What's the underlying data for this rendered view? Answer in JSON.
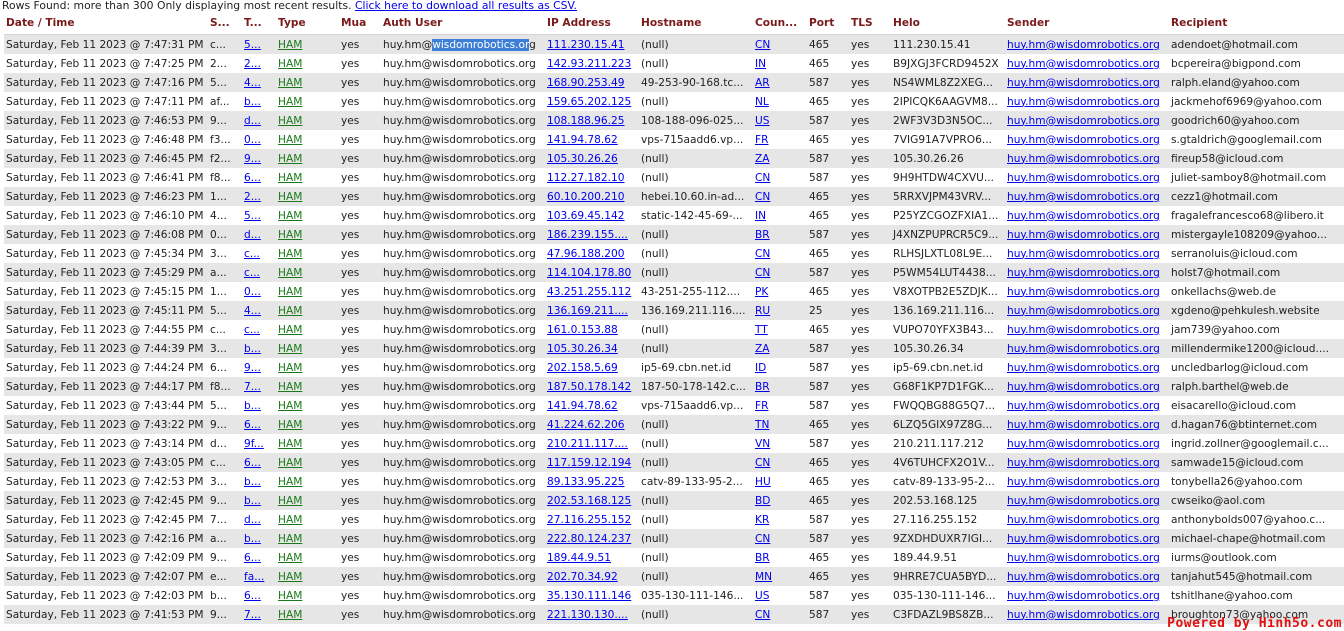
{
  "info": {
    "text": "Rows Found: more than 300 Only displaying most recent results.",
    "link": "Click here to download all results as CSV."
  },
  "columns": [
    "Date / Time",
    "S...",
    "T...",
    "Type",
    "Mua",
    "Auth User",
    "IP Address",
    "Hostname",
    "Coun...",
    "Port",
    "TLS",
    "Helo",
    "Sender",
    "Recipient"
  ],
  "rows": [
    {
      "date": "Saturday, Feb 11 2023 @ 7:47:31 PM",
      "s": "c...",
      "t": "5...",
      "type": "HAM",
      "mua": "yes",
      "auth": "huy.hm@wisdomrobotics.org",
      "ip": "111.230.15.41",
      "host": "(null)",
      "country": "CN",
      "port": "465",
      "tls": "yes",
      "helo": "111.230.15.41",
      "sender": "huy.hm@wisdomrobotics.org",
      "recipient": "adendoet@hotmail.com"
    },
    {
      "date": "Saturday, Feb 11 2023 @ 7:47:25 PM",
      "s": "2...",
      "t": "2...",
      "type": "HAM",
      "mua": "yes",
      "auth": "huy.hm@wisdomrobotics.org",
      "ip": "142.93.211.223",
      "host": "(null)",
      "country": "IN",
      "port": "465",
      "tls": "yes",
      "helo": "B9JXGJ3FCRD9452X",
      "sender": "huy.hm@wisdomrobotics.org",
      "recipient": "bcpereira@bigpond.com"
    },
    {
      "date": "Saturday, Feb 11 2023 @ 7:47:16 PM",
      "s": "5...",
      "t": "4...",
      "type": "HAM",
      "mua": "yes",
      "auth": "huy.hm@wisdomrobotics.org",
      "ip": "168.90.253.49",
      "host": "49-253-90-168.tc...",
      "country": "AR",
      "port": "587",
      "tls": "yes",
      "helo": "NS4WML8Z2XEG...",
      "sender": "huy.hm@wisdomrobotics.org",
      "recipient": "ralph.eland@yahoo.com"
    },
    {
      "date": "Saturday, Feb 11 2023 @ 7:47:11 PM",
      "s": "af...",
      "t": "b...",
      "type": "HAM",
      "mua": "yes",
      "auth": "huy.hm@wisdomrobotics.org",
      "ip": "159.65.202.125",
      "host": "(null)",
      "country": "NL",
      "port": "465",
      "tls": "yes",
      "helo": "2IPICQK6AAGVM8...",
      "sender": "huy.hm@wisdomrobotics.org",
      "recipient": "jackmehof6969@yahoo.com"
    },
    {
      "date": "Saturday, Feb 11 2023 @ 7:46:53 PM",
      "s": "9...",
      "t": "d...",
      "type": "HAM",
      "mua": "yes",
      "auth": "huy.hm@wisdomrobotics.org",
      "ip": "108.188.96.25",
      "host": "108-188-096-025...",
      "country": "US",
      "port": "587",
      "tls": "yes",
      "helo": "2WF3V3D3N5OC...",
      "sender": "huy.hm@wisdomrobotics.org",
      "recipient": "goodrich60@yahoo.com"
    },
    {
      "date": "Saturday, Feb 11 2023 @ 7:46:48 PM",
      "s": "f3...",
      "t": "0...",
      "type": "HAM",
      "mua": "yes",
      "auth": "huy.hm@wisdomrobotics.org",
      "ip": "141.94.78.62",
      "host": "vps-715aadd6.vp...",
      "country": "FR",
      "port": "465",
      "tls": "yes",
      "helo": "7VIG91A7VPRO6...",
      "sender": "huy.hm@wisdomrobotics.org",
      "recipient": "s.gtaldrich@googlemail.com"
    },
    {
      "date": "Saturday, Feb 11 2023 @ 7:46:45 PM",
      "s": "f2...",
      "t": "9...",
      "type": "HAM",
      "mua": "yes",
      "auth": "huy.hm@wisdomrobotics.org",
      "ip": "105.30.26.26",
      "host": "(null)",
      "country": "ZA",
      "port": "587",
      "tls": "yes",
      "helo": "105.30.26.26",
      "sender": "huy.hm@wisdomrobotics.org",
      "recipient": "fireup58@icloud.com"
    },
    {
      "date": "Saturday, Feb 11 2023 @ 7:46:41 PM",
      "s": "f8...",
      "t": "6...",
      "type": "HAM",
      "mua": "yes",
      "auth": "huy.hm@wisdomrobotics.org",
      "ip": "112.27.182.10",
      "host": "(null)",
      "country": "CN",
      "port": "587",
      "tls": "yes",
      "helo": "9H9HTDW4CXVU...",
      "sender": "huy.hm@wisdomrobotics.org",
      "recipient": "juliet-samboy8@hotmail.com"
    },
    {
      "date": "Saturday, Feb 11 2023 @ 7:46:23 PM",
      "s": "1...",
      "t": "2...",
      "type": "HAM",
      "mua": "yes",
      "auth": "huy.hm@wisdomrobotics.org",
      "ip": "60.10.200.210",
      "host": "hebei.10.60.in-ad...",
      "country": "CN",
      "port": "465",
      "tls": "yes",
      "helo": "5RRXVJPM43VRV...",
      "sender": "huy.hm@wisdomrobotics.org",
      "recipient": "cezz1@hotmail.com"
    },
    {
      "date": "Saturday, Feb 11 2023 @ 7:46:10 PM",
      "s": "4...",
      "t": "5...",
      "type": "HAM",
      "mua": "yes",
      "auth": "huy.hm@wisdomrobotics.org",
      "ip": "103.69.45.142",
      "host": "static-142-45-69-...",
      "country": "IN",
      "port": "465",
      "tls": "yes",
      "helo": "P25YZCGOZFXIA1...",
      "sender": "huy.hm@wisdomrobotics.org",
      "recipient": "fragalefrancesco68@libero.it"
    },
    {
      "date": "Saturday, Feb 11 2023 @ 7:46:08 PM",
      "s": "0...",
      "t": "d...",
      "type": "HAM",
      "mua": "yes",
      "auth": "huy.hm@wisdomrobotics.org",
      "ip": "186.239.155....",
      "host": "(null)",
      "country": "BR",
      "port": "587",
      "tls": "yes",
      "helo": "J4XNZPUPRCR5C9...",
      "sender": "huy.hm@wisdomrobotics.org",
      "recipient": "mistergayle108209@yahoo..."
    },
    {
      "date": "Saturday, Feb 11 2023 @ 7:45:34 PM",
      "s": "3...",
      "t": "c...",
      "type": "HAM",
      "mua": "yes",
      "auth": "huy.hm@wisdomrobotics.org",
      "ip": "47.96.188.200",
      "host": "(null)",
      "country": "CN",
      "port": "465",
      "tls": "yes",
      "helo": "RLHSJLXTL08L9E...",
      "sender": "huy.hm@wisdomrobotics.org",
      "recipient": "serranoluis@icloud.com"
    },
    {
      "date": "Saturday, Feb 11 2023 @ 7:45:29 PM",
      "s": "a...",
      "t": "c...",
      "type": "HAM",
      "mua": "yes",
      "auth": "huy.hm@wisdomrobotics.org",
      "ip": "114.104.178.80",
      "host": "(null)",
      "country": "CN",
      "port": "587",
      "tls": "yes",
      "helo": "P5WM54LUT4438...",
      "sender": "huy.hm@wisdomrobotics.org",
      "recipient": "holst7@hotmail.com"
    },
    {
      "date": "Saturday, Feb 11 2023 @ 7:45:15 PM",
      "s": "1...",
      "t": "0...",
      "type": "HAM",
      "mua": "yes",
      "auth": "huy.hm@wisdomrobotics.org",
      "ip": "43.251.255.112",
      "host": "43-251-255-112....",
      "country": "PK",
      "port": "465",
      "tls": "yes",
      "helo": "V8XOTPB2E5ZDJK...",
      "sender": "huy.hm@wisdomrobotics.org",
      "recipient": "onkellachs@web.de"
    },
    {
      "date": "Saturday, Feb 11 2023 @ 7:45:11 PM",
      "s": "5...",
      "t": "4...",
      "type": "HAM",
      "mua": "yes",
      "auth": "huy.hm@wisdomrobotics.org",
      "ip": "136.169.211....",
      "host": "136.169.211.116....",
      "country": "RU",
      "port": "25",
      "tls": "yes",
      "helo": "136.169.211.116...",
      "sender": "huy.hm@wisdomrobotics.org",
      "recipient": "xgdeno@pehkulesh.website"
    },
    {
      "date": "Saturday, Feb 11 2023 @ 7:44:55 PM",
      "s": "c...",
      "t": "c...",
      "type": "HAM",
      "mua": "yes",
      "auth": "huy.hm@wisdomrobotics.org",
      "ip": "161.0.153.88",
      "host": "(null)",
      "country": "TT",
      "port": "465",
      "tls": "yes",
      "helo": "VUPO70YFX3B43...",
      "sender": "huy.hm@wisdomrobotics.org",
      "recipient": "jam739@yahoo.com"
    },
    {
      "date": "Saturday, Feb 11 2023 @ 7:44:39 PM",
      "s": "3...",
      "t": "b...",
      "type": "HAM",
      "mua": "yes",
      "auth": "huy.hm@wisdomrobotics.org",
      "ip": "105.30.26.34",
      "host": "(null)",
      "country": "ZA",
      "port": "587",
      "tls": "yes",
      "helo": "105.30.26.34",
      "sender": "huy.hm@wisdomrobotics.org",
      "recipient": "millendermike1200@icloud...."
    },
    {
      "date": "Saturday, Feb 11 2023 @ 7:44:24 PM",
      "s": "6...",
      "t": "9...",
      "type": "HAM",
      "mua": "yes",
      "auth": "huy.hm@wisdomrobotics.org",
      "ip": "202.158.5.69",
      "host": "ip5-69.cbn.net.id",
      "country": "ID",
      "port": "587",
      "tls": "yes",
      "helo": "ip5-69.cbn.net.id",
      "sender": "huy.hm@wisdomrobotics.org",
      "recipient": "uncledbarlog@icloud.com"
    },
    {
      "date": "Saturday, Feb 11 2023 @ 7:44:17 PM",
      "s": "f8...",
      "t": "7...",
      "type": "HAM",
      "mua": "yes",
      "auth": "huy.hm@wisdomrobotics.org",
      "ip": "187.50.178.142",
      "host": "187-50-178-142.c...",
      "country": "BR",
      "port": "587",
      "tls": "yes",
      "helo": "G68F1KP7D1FGK...",
      "sender": "huy.hm@wisdomrobotics.org",
      "recipient": "ralph.barthel@web.de"
    },
    {
      "date": "Saturday, Feb 11 2023 @ 7:43:44 PM",
      "s": "5...",
      "t": "b...",
      "type": "HAM",
      "mua": "yes",
      "auth": "huy.hm@wisdomrobotics.org",
      "ip": "141.94.78.62",
      "host": "vps-715aadd6.vp...",
      "country": "FR",
      "port": "587",
      "tls": "yes",
      "helo": "FWQQBG88G5Q7...",
      "sender": "huy.hm@wisdomrobotics.org",
      "recipient": "eisacarello@icloud.com"
    },
    {
      "date": "Saturday, Feb 11 2023 @ 7:43:22 PM",
      "s": "9...",
      "t": "6...",
      "type": "HAM",
      "mua": "yes",
      "auth": "huy.hm@wisdomrobotics.org",
      "ip": "41.224.62.206",
      "host": "(null)",
      "country": "TN",
      "port": "465",
      "tls": "yes",
      "helo": "6LZQ5GIX97Z8G...",
      "sender": "huy.hm@wisdomrobotics.org",
      "recipient": "d.hagan76@btinternet.com"
    },
    {
      "date": "Saturday, Feb 11 2023 @ 7:43:14 PM",
      "s": "d...",
      "t": "9f...",
      "type": "HAM",
      "mua": "yes",
      "auth": "huy.hm@wisdomrobotics.org",
      "ip": "210.211.117....",
      "host": "(null)",
      "country": "VN",
      "port": "587",
      "tls": "yes",
      "helo": "210.211.117.212",
      "sender": "huy.hm@wisdomrobotics.org",
      "recipient": "ingrid.zollner@googlemail.c..."
    },
    {
      "date": "Saturday, Feb 11 2023 @ 7:43:05 PM",
      "s": "c...",
      "t": "6...",
      "type": "HAM",
      "mua": "yes",
      "auth": "huy.hm@wisdomrobotics.org",
      "ip": "117.159.12.194",
      "host": "(null)",
      "country": "CN",
      "port": "465",
      "tls": "yes",
      "helo": "4V6TUHCFX2O1V...",
      "sender": "huy.hm@wisdomrobotics.org",
      "recipient": "samwade15@icloud.com"
    },
    {
      "date": "Saturday, Feb 11 2023 @ 7:42:53 PM",
      "s": "3...",
      "t": "b...",
      "type": "HAM",
      "mua": "yes",
      "auth": "huy.hm@wisdomrobotics.org",
      "ip": "89.133.95.225",
      "host": "catv-89-133-95-2...",
      "country": "HU",
      "port": "465",
      "tls": "yes",
      "helo": "catv-89-133-95-2...",
      "sender": "huy.hm@wisdomrobotics.org",
      "recipient": "tonybella26@yahoo.com"
    },
    {
      "date": "Saturday, Feb 11 2023 @ 7:42:45 PM",
      "s": "9...",
      "t": "b...",
      "type": "HAM",
      "mua": "yes",
      "auth": "huy.hm@wisdomrobotics.org",
      "ip": "202.53.168.125",
      "host": "(null)",
      "country": "BD",
      "port": "465",
      "tls": "yes",
      "helo": "202.53.168.125",
      "sender": "huy.hm@wisdomrobotics.org",
      "recipient": "cwseiko@aol.com"
    },
    {
      "date": "Saturday, Feb 11 2023 @ 7:42:45 PM",
      "s": "7...",
      "t": "d...",
      "type": "HAM",
      "mua": "yes",
      "auth": "huy.hm@wisdomrobotics.org",
      "ip": "27.116.255.152",
      "host": "(null)",
      "country": "KR",
      "port": "587",
      "tls": "yes",
      "helo": "27.116.255.152",
      "sender": "huy.hm@wisdomrobotics.org",
      "recipient": "anthonybolds007@yahoo.c..."
    },
    {
      "date": "Saturday, Feb 11 2023 @ 7:42:16 PM",
      "s": "a...",
      "t": "b...",
      "type": "HAM",
      "mua": "yes",
      "auth": "huy.hm@wisdomrobotics.org",
      "ip": "222.80.124.237",
      "host": "(null)",
      "country": "CN",
      "port": "587",
      "tls": "yes",
      "helo": "9ZXDHDUXR7IGI...",
      "sender": "huy.hm@wisdomrobotics.org",
      "recipient": "michael-chape@hotmail.com"
    },
    {
      "date": "Saturday, Feb 11 2023 @ 7:42:09 PM",
      "s": "9...",
      "t": "6...",
      "type": "HAM",
      "mua": "yes",
      "auth": "huy.hm@wisdomrobotics.org",
      "ip": "189.44.9.51",
      "host": "(null)",
      "country": "BR",
      "port": "465",
      "tls": "yes",
      "helo": "189.44.9.51",
      "sender": "huy.hm@wisdomrobotics.org",
      "recipient": "iurms@outlook.com"
    },
    {
      "date": "Saturday, Feb 11 2023 @ 7:42:07 PM",
      "s": "e...",
      "t": "fa...",
      "type": "HAM",
      "mua": "yes",
      "auth": "huy.hm@wisdomrobotics.org",
      "ip": "202.70.34.92",
      "host": "(null)",
      "country": "MN",
      "port": "465",
      "tls": "yes",
      "helo": "9HRRE7CUA5BYD...",
      "sender": "huy.hm@wisdomrobotics.org",
      "recipient": "tanjahut545@hotmail.com"
    },
    {
      "date": "Saturday, Feb 11 2023 @ 7:42:03 PM",
      "s": "b...",
      "t": "6...",
      "type": "HAM",
      "mua": "yes",
      "auth": "huy.hm@wisdomrobotics.org",
      "ip": "35.130.111.146",
      "host": "035-130-111-146...",
      "country": "US",
      "port": "587",
      "tls": "yes",
      "helo": "035-130-111-146...",
      "sender": "huy.hm@wisdomrobotics.org",
      "recipient": "tshitlhane@yahoo.com"
    },
    {
      "date": "Saturday, Feb 11 2023 @ 7:41:53 PM",
      "s": "9...",
      "t": "7...",
      "type": "HAM",
      "mua": "yes",
      "auth": "huy.hm@wisdomrobotics.org",
      "ip": "221.130.130....",
      "host": "(null)",
      "country": "CN",
      "port": "587",
      "tls": "yes",
      "helo": "C3FDAZL9BS8ZB...",
      "sender": "huy.hm@wisdomrobotics.org",
      "recipient": "broughton73@yahoo.com"
    }
  ],
  "selection": {
    "before": "huy.hm@",
    "selected": "wisdomrobotics.or",
    "after": "g"
  },
  "footer": {
    "powered": "Powered by Hinh5o.com"
  },
  "colors": {
    "header_text": "#7a1a1a",
    "link": "#0000ee",
    "ham": "#1a7a1a",
    "row_alt": "#e6e6e6",
    "selection": "#3d7fd6",
    "powered": "#e01010"
  }
}
